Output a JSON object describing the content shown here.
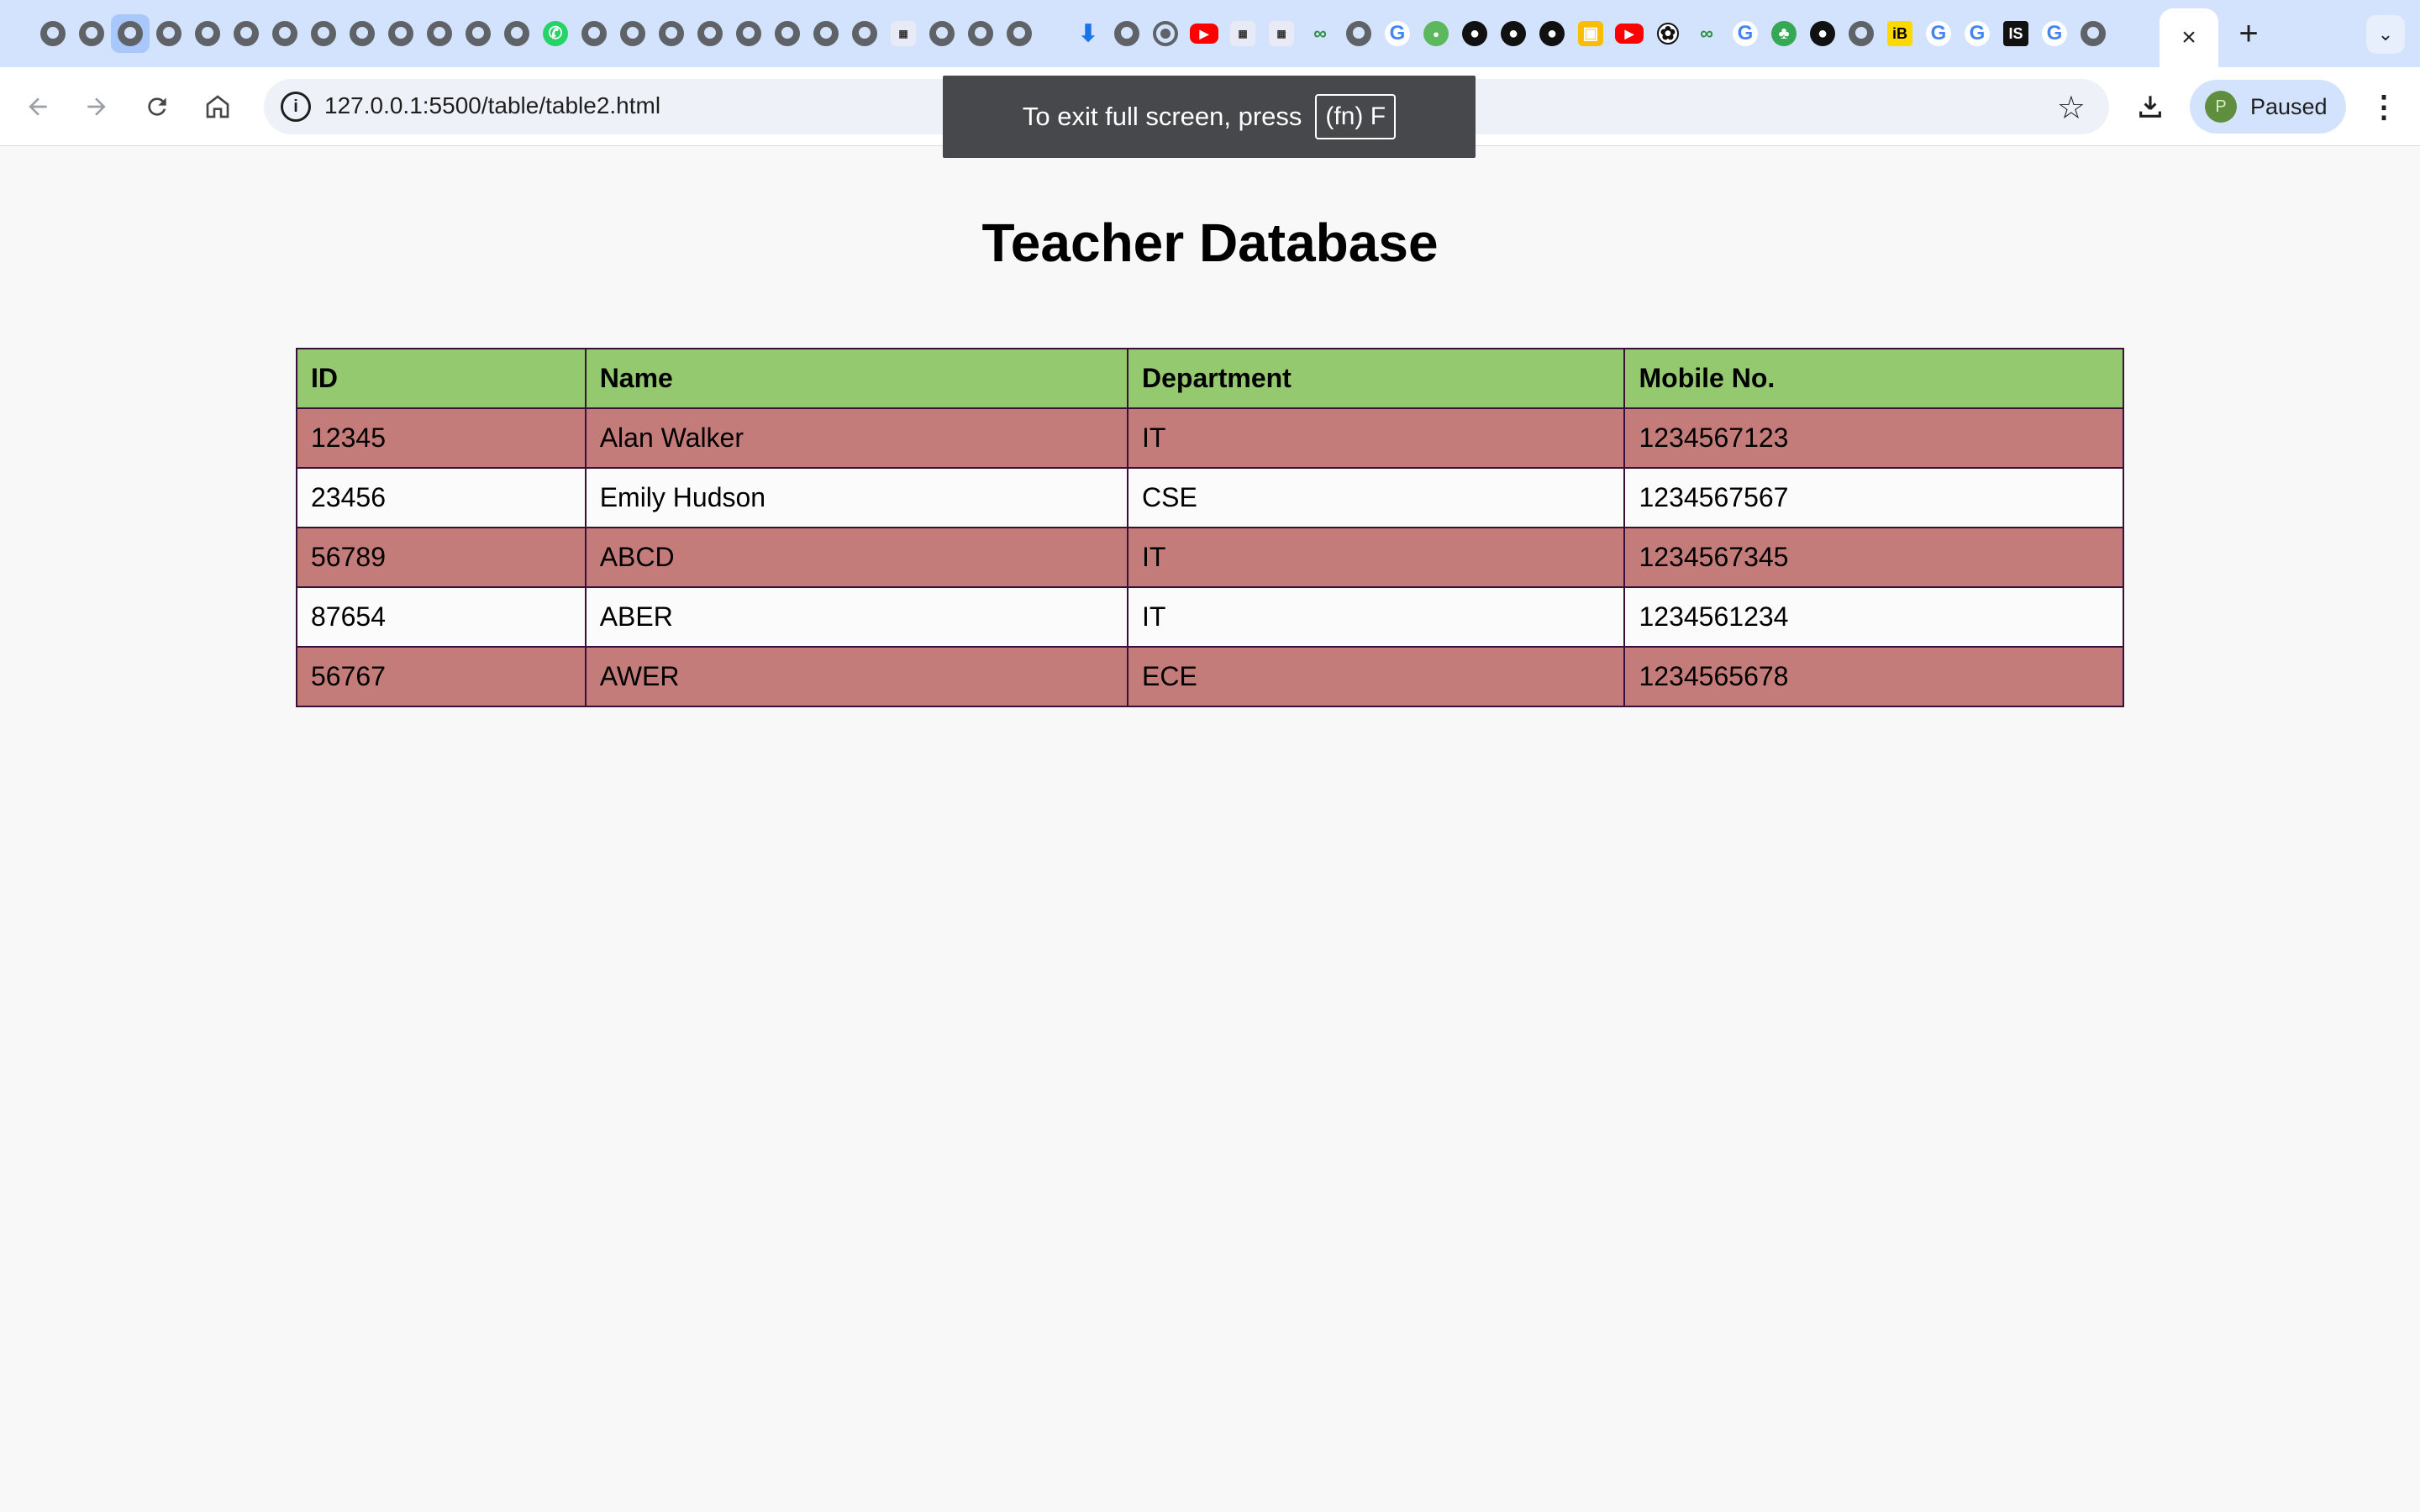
{
  "browser": {
    "tab_icons_group1": [
      "globe",
      "globe",
      "globe",
      "globe",
      "globe",
      "globe",
      "globe",
      "globe",
      "globe",
      "globe",
      "globe",
      "globe",
      "globe",
      "whatsapp",
      "globe",
      "globe",
      "globe",
      "globe",
      "globe",
      "globe",
      "globe",
      "globe",
      "bol",
      "globe",
      "globe",
      "globe"
    ],
    "tab_icons_group2": [
      "download",
      "globe",
      "chrome",
      "youtube",
      "bol",
      "bol",
      "gfg",
      "globe",
      "google",
      "green-circle",
      "github",
      "github",
      "github",
      "photo",
      "youtube",
      "chatgpt",
      "gfg",
      "google",
      "leaf",
      "github",
      "globe",
      "interviewbit",
      "google",
      "google",
      "is",
      "google",
      "globe"
    ],
    "active_tab_close": "×",
    "new_tab_label": "+",
    "tab_search_label": "⌄",
    "url": "127.0.0.1:5500/table/table2.html",
    "profile_initial": "P",
    "profile_status": "Paused",
    "fullscreen_toast": {
      "message": "To exit full screen, press",
      "key": "(fn) F"
    }
  },
  "page": {
    "title": "Teacher Database",
    "table": {
      "headers": [
        "ID",
        "Name",
        "Department",
        "Mobile No."
      ],
      "rows": [
        [
          "12345",
          "Alan Walker",
          "IT",
          "1234567123"
        ],
        [
          "23456",
          "Emily Hudson",
          "CSE",
          "1234567567"
        ],
        [
          "56789",
          "ABCD",
          "IT",
          "1234567345"
        ],
        [
          "87654",
          "ABER",
          "IT",
          "1234561234"
        ],
        [
          "56767",
          "AWER",
          "ECE",
          "1234565678"
        ]
      ]
    }
  },
  "colors": {
    "header_bg": "#95c96f",
    "odd_row_bg": "#c47c7a",
    "even_row_bg": "#fbfbfb",
    "border": "#3a0f3a",
    "tabstrip_bg": "#d3e3fd"
  }
}
